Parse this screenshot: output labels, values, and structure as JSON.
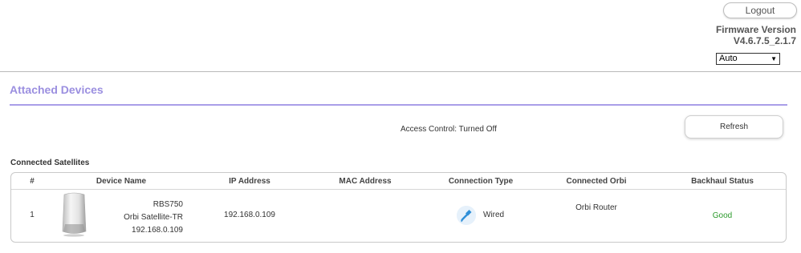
{
  "header": {
    "logout_label": "Logout",
    "firmware_label": "Firmware Version",
    "firmware_version": "V4.6.7.5_2.1.7",
    "language_selected": "Auto"
  },
  "page": {
    "title": "Attached Devices",
    "access_control": "Access Control: Turned Off",
    "refresh_label": "Refresh"
  },
  "satellites": {
    "section_title": "Connected Satellites",
    "columns": [
      "#",
      "Device Name",
      "IP Address",
      "MAC Address",
      "Connection Type",
      "Connected Orbi",
      "Backhaul Status"
    ],
    "rows": [
      {
        "index": "1",
        "device_model": "RBS750",
        "device_name": "Orbi Satellite-TR",
        "device_ip": "192.168.0.109",
        "ip_address": "192.168.0.109",
        "mac_address": "",
        "connection_type": "Wired",
        "connected_orbi": "Orbi Router",
        "backhaul_status": "Good"
      }
    ]
  },
  "colors": {
    "accent": "#9b8fe0",
    "status_good": "#2b9a2b",
    "wired_icon": "#2f8fd8"
  }
}
